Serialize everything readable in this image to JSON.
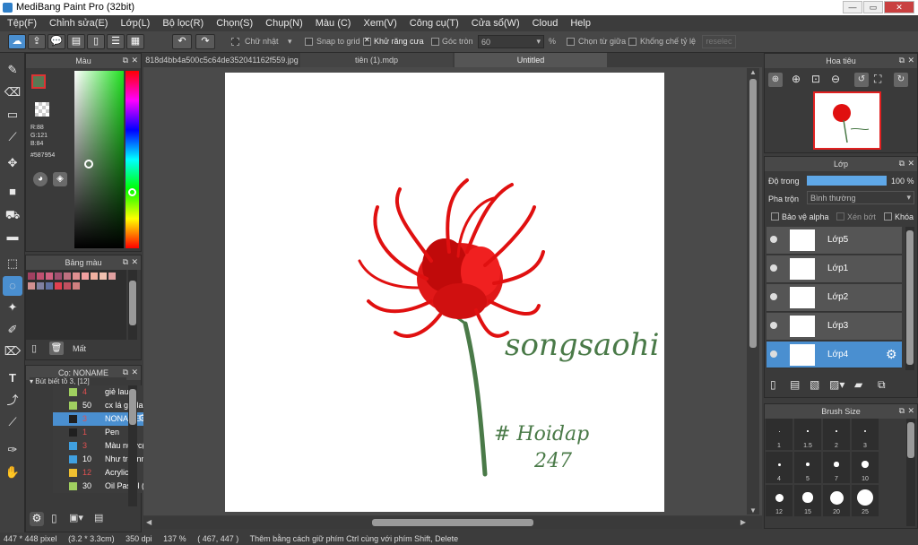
{
  "window": {
    "title": "MediBang Paint Pro (32bit)",
    "min": "—",
    "max": "▭",
    "close": "✕"
  },
  "menu": [
    "Tệp(F)",
    "Chỉnh sửa(E)",
    "Lớp(L)",
    "Bộ lọc(R)",
    "Chọn(S)",
    "Chụp(N)",
    "Màu (C)",
    "Xem(V)",
    "Công cụ(T)",
    "Cửa sổ(W)",
    "Cloud",
    "Help"
  ],
  "toolbar": {
    "shape": "Chữ nhật",
    "snap": "Snap to grid",
    "antialias": "Khử răng cưa",
    "round_corner": "Góc tròn",
    "value": "60",
    "percent": "%",
    "center": "Chọn từ giữa",
    "ratio": "Khống chế tỷ lệ",
    "reselect": "reselec"
  },
  "color_panel": {
    "title": "Màu",
    "r": "R:88",
    "g": "G:121",
    "b": "B:84",
    "hex": "#587954",
    "color": "#587954"
  },
  "palette_panel": {
    "title": "Bảng màu",
    "delete_label": "Mất",
    "swatches": [
      "#a04060",
      "#c05070",
      "#d06080",
      "#a05070",
      "#c07080",
      "#e09090",
      "#f0a0a0",
      "#f0b0a0",
      "#f0c0b0",
      "#e0a0a0",
      "#d09090",
      "#8080a0",
      "#6070a0",
      "#e04050",
      "#c05060",
      "#d08080"
    ]
  },
  "brush_panel": {
    "title": "Cọ: NONAME",
    "group": "Bút biết tồ 3, [12]",
    "items": [
      {
        "size": "4",
        "label": "giẻ lau",
        "color": "#a0d060",
        "numColor": "#e05050"
      },
      {
        "size": "50",
        "label": "cx lá giẻ lau",
        "color": "#a0d060",
        "numColor": "#ffffff"
      },
      {
        "size": "3",
        "label": "NONAME",
        "color": "#202020",
        "numColor": "#e05050"
      },
      {
        "size": "1",
        "label": "Pen",
        "color": "#202020",
        "numColor": "#e05050"
      },
      {
        "size": "3",
        "label": "Màu nước(c",
        "color": "#40a0e0",
        "numColor": "#e05050"
      },
      {
        "size": "10",
        "label": "Như trênnn",
        "color": "#40a0e0",
        "numColor": "#ffffff"
      },
      {
        "size": "12",
        "label": "Acrylic",
        "color": "#f0c030",
        "numColor": "#e05050"
      },
      {
        "size": "30",
        "label": "Oil Pastel (t",
        "color": "#a0d060",
        "numColor": "#ffffff"
      }
    ]
  },
  "tabs": [
    "818d4bb4a500c5c64de352041162f559.jpg",
    "tiên (1).mdp",
    "Untitled"
  ],
  "artwork": {
    "signature": "songsaohi",
    "hashtag": "# Hoidap",
    "number": "247"
  },
  "navigator": {
    "title": "Hoa tiêu"
  },
  "layer_panel": {
    "title": "Lớp",
    "opacity_label": "Độ trong",
    "opacity_value": "100 %",
    "opacity": 1.0,
    "blend_label": "Pha trộn",
    "blend_value": "Bình thường",
    "protect_alpha": "Bảo vệ alpha",
    "clip": "Xén bớt",
    "lock": "Khóa",
    "layers": [
      "Lớp5",
      "Lớp1",
      "Lớp2",
      "Lớp3",
      "Lớp4"
    ]
  },
  "brushsize_panel": {
    "title": "Brush Size",
    "sizes": [
      "1",
      "1.5",
      "2",
      "3",
      "4",
      "5",
      "7",
      "10",
      "12",
      "15",
      "20",
      "25"
    ]
  },
  "status": {
    "size": "447 * 448 pixel",
    "cm": "(3.2 * 3.3cm)",
    "dpi": "350 dpi",
    "zoom": "137 %",
    "coords": "( 467, 447 )",
    "hint": "Thêm bằng cách giữ phím Ctrl cùng với phím Shift, Delete"
  }
}
